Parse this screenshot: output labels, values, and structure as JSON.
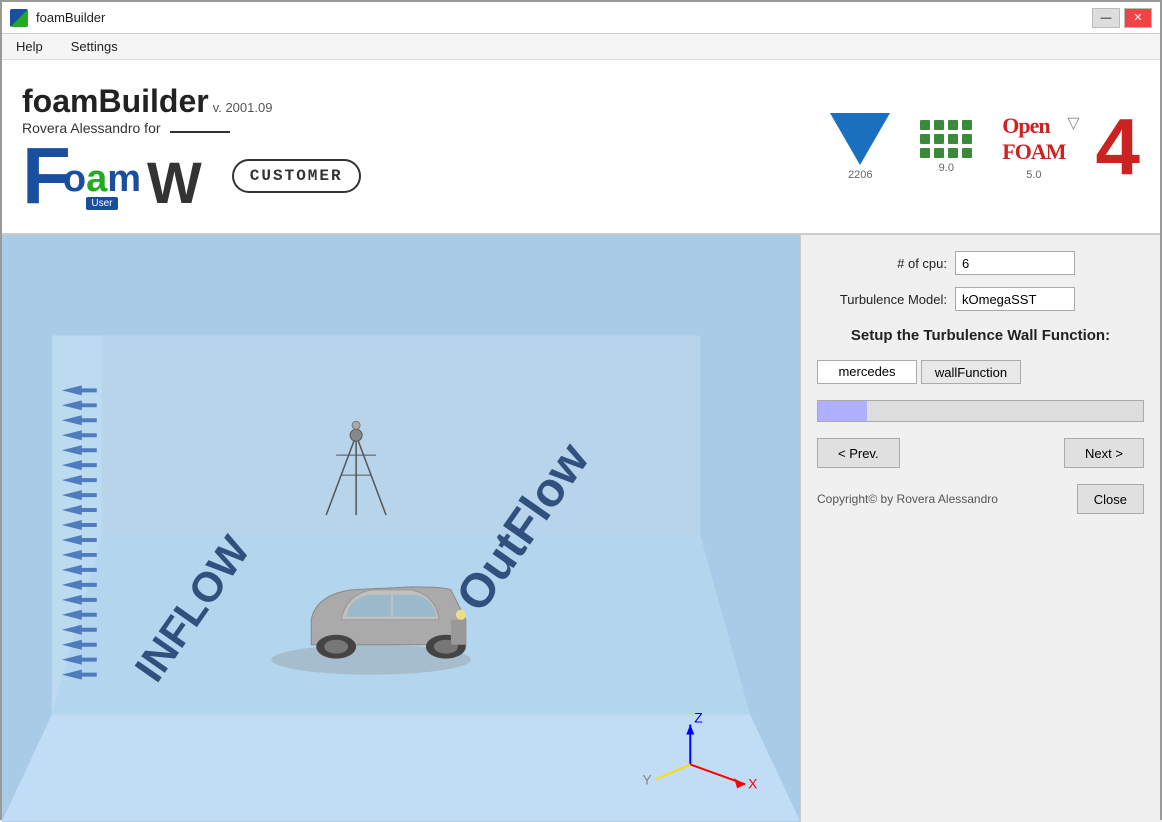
{
  "titleBar": {
    "icon": "foam-builder-icon",
    "title": "foamBuilder",
    "minimizeLabel": "—",
    "closeLabel": "✕"
  },
  "menuBar": {
    "items": [
      "Help",
      "Settings"
    ]
  },
  "header": {
    "appTitle": "foamBuilder",
    "version": "v. 2001.09",
    "author": "Rovera Alessandro for",
    "authorUnderline": "___________",
    "foamText": "Foam",
    "userBadge": "User",
    "customerLabel": "CUSTOMER",
    "logos": {
      "triangle": {
        "label": "2206"
      },
      "dots": {
        "label": "9.0"
      },
      "openfoam": {
        "text": "OpenFOAM",
        "version": "▽",
        "label": "5.0"
      },
      "bigNumber": "4"
    }
  },
  "rightPanel": {
    "cpuLabel": "# of cpu:",
    "cpuValue": "6",
    "turbulenceLabel": "Turbulence Model:",
    "turbulenceValue": "kOmegaSST",
    "wallFunctionTitle": "Setup the Turbulence Wall Function:",
    "wallFunctionPatch": "mercedes",
    "wallFunctionBtn": "wallFunction",
    "prevBtn": "< Prev.",
    "nextBtn": "Next >",
    "copyright": "Copyright© by Rovera Alessandro",
    "closeBtn": "Close"
  },
  "viewport": {
    "sceneDescription": "3D CFD simulation scene with car model"
  }
}
